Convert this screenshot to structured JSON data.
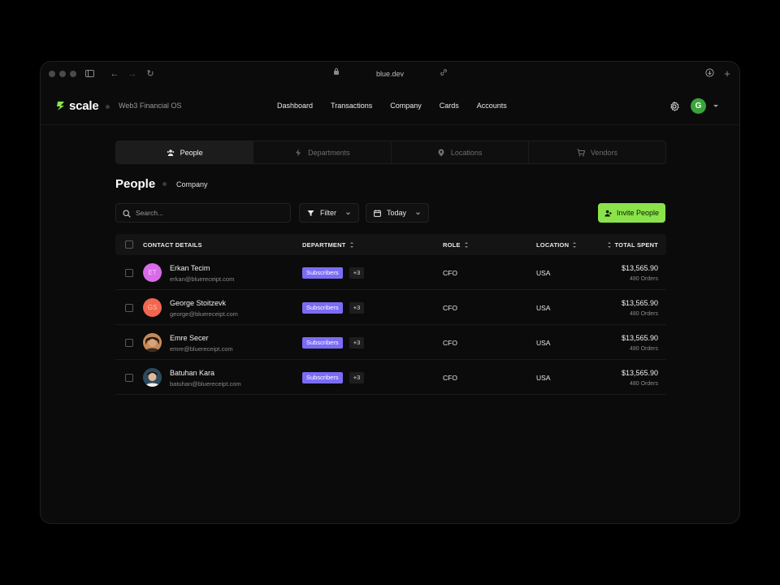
{
  "browser": {
    "url": "blue.dev"
  },
  "app": {
    "brand": "scale",
    "tagline": "Web3 Financial OS",
    "nav": [
      "Dashboard",
      "Transactions",
      "Company",
      "Cards",
      "Accounts"
    ],
    "user_initial": "G"
  },
  "tabs": [
    {
      "label": "People",
      "icon": "people-icon",
      "active": true
    },
    {
      "label": "Departments",
      "icon": "bolt-icon",
      "active": false
    },
    {
      "label": "Locations",
      "icon": "pin-icon",
      "active": false
    },
    {
      "label": "Vendors",
      "icon": "cart-icon",
      "active": false
    }
  ],
  "page": {
    "title": "People",
    "subtitle": "Company"
  },
  "toolbar": {
    "search_placeholder": "Search...",
    "filter_label": "Filter",
    "date_label": "Today",
    "invite_label": "Invite People"
  },
  "table": {
    "columns": {
      "contact": "CONTACT DETAILS",
      "department": "DEPARTMENT",
      "role": "ROLE",
      "location": "LOCATION",
      "total": "TOTAL SPENT"
    },
    "rows": [
      {
        "name": "Erkan Tecim",
        "email": "erkan@bluereceipt.com",
        "initials": "ET",
        "avatar_color": "#d96be8",
        "department": "Subscribers",
        "more": "+3",
        "role": "CFO",
        "location": "USA",
        "amount": "$13,565.90",
        "orders": "480 Orders"
      },
      {
        "name": "George Stoitzevk",
        "email": "george@bluereceipt.com",
        "initials": "GS",
        "avatar_color": "#f2664f",
        "department": "Subscribers",
        "more": "+3",
        "role": "CFO",
        "location": "USA",
        "amount": "$13,565.90",
        "orders": "480 Orders"
      },
      {
        "name": "Emre Secer",
        "email": "emre@bluereceipt.com",
        "initials": "",
        "avatar_color": "#7a4a2e",
        "department": "Subscribers",
        "more": "+3",
        "role": "CFO",
        "location": "USA",
        "amount": "$13,565.90",
        "orders": "480 Orders"
      },
      {
        "name": "Batuhan Kara",
        "email": "batuhan@bluereceipt.com",
        "initials": "",
        "avatar_color": "#2d4a5e",
        "department": "Subscribers",
        "more": "+3",
        "role": "CFO",
        "location": "USA",
        "amount": "$13,565.90",
        "orders": "480 Orders"
      }
    ]
  },
  "colors": {
    "accent_green": "#8ae34a",
    "tag_purple": "#7b6cf6",
    "avatar_green": "#3aa53a"
  }
}
